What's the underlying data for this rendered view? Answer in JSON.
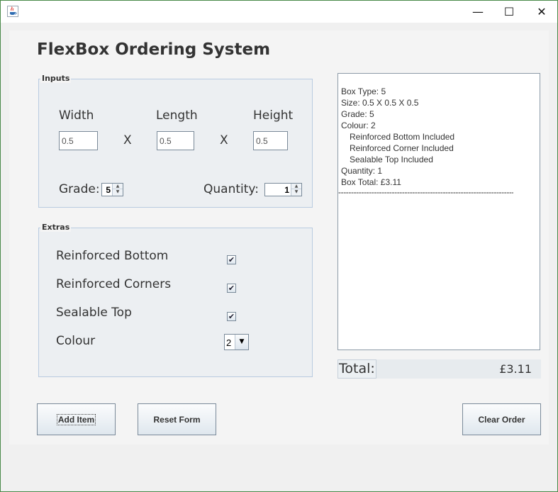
{
  "window": {
    "title": "",
    "minimize_glyph": "—",
    "maximize_glyph": "☐",
    "close_glyph": "✕"
  },
  "app": {
    "title": "FlexBox Ordering System"
  },
  "inputs": {
    "group_title": "Inputs",
    "width_label": "Width",
    "length_label": "Length",
    "height_label": "Height",
    "width_value": "0.5",
    "length_value": "0.5",
    "height_value": "0.5",
    "x_separator": "X",
    "grade_label": "Grade:",
    "grade_value": "5",
    "quantity_label": "Quantity:",
    "quantity_value": "1"
  },
  "extras": {
    "group_title": "Extras",
    "reinforced_bottom_label": "Reinforced Bottom",
    "reinforced_corners_label": "Reinforced Corners",
    "sealable_top_label": "Sealable Top",
    "colour_label": "Colour",
    "check_glyph": "✔",
    "reinforced_bottom_checked": true,
    "reinforced_corners_checked": true,
    "sealable_top_checked": true,
    "colour_value": "2",
    "dropdown_glyph": "▼"
  },
  "receipt": {
    "lines": [
      "Box Type: 5",
      "Size: 0.5 X 0.5 X 0.5",
      "Grade: 5",
      "Colour: 2",
      "Reinforced Bottom Included",
      "Reinforced Corner Included",
      "Sealable Top Included",
      "Quantity: 1",
      "Box Total: £3.11"
    ],
    "rule": "------------------------------------------------------------------------------"
  },
  "total": {
    "label": "Total:",
    "value": "£3.11"
  },
  "buttons": {
    "add_item": "Add Item",
    "reset_form": "Reset Form",
    "clear_order": "Clear Order"
  },
  "colors": {
    "title_bar": "#ffffff",
    "panel_bg": "#f4f4f4",
    "group_bg": "#eceff2",
    "group_border": "#b9cbe0",
    "window_border": "#4a8a4a"
  },
  "icons": {
    "app_icon": "java-coffee-cup-icon"
  }
}
